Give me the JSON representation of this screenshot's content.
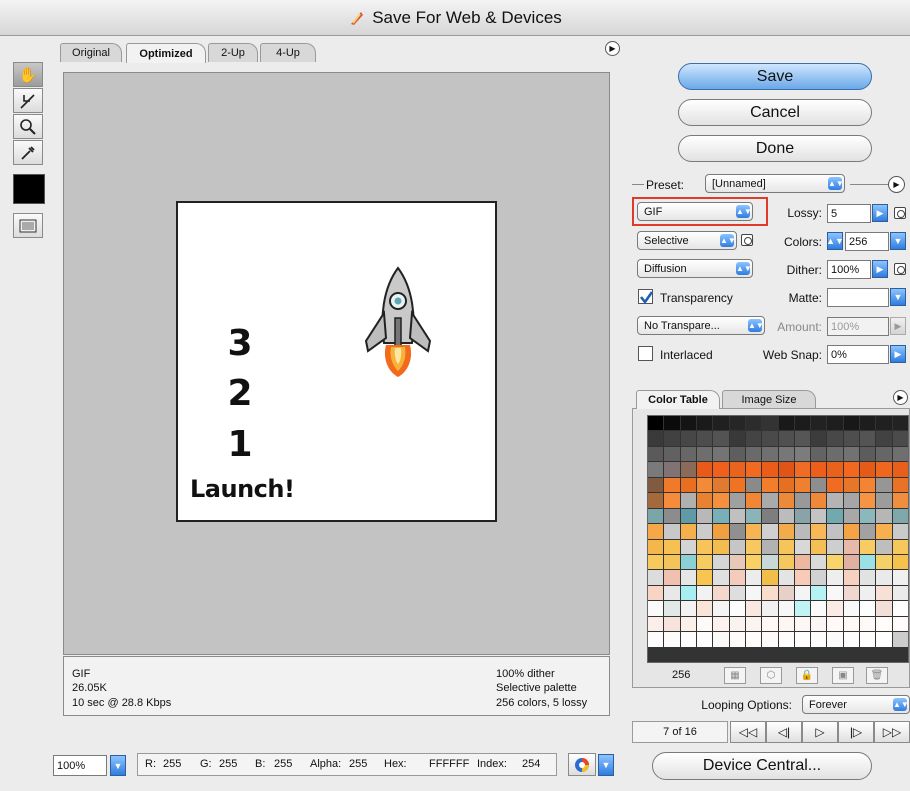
{
  "window": {
    "title": "Save For Web & Devices"
  },
  "tabs": [
    {
      "label": "Original",
      "active": false
    },
    {
      "label": "Optimized",
      "active": true
    },
    {
      "label": "2-Up",
      "active": false
    },
    {
      "label": "4-Up",
      "active": false
    }
  ],
  "toolbox": {
    "tools": [
      "hand-tool",
      "slice-select-tool",
      "zoom-tool",
      "eyedropper-tool"
    ],
    "eyedropper_color": "#000000"
  },
  "preview": {
    "count": [
      "3",
      "2",
      "1"
    ],
    "launch_text": "Launch!"
  },
  "info_left": [
    "GIF",
    "26.05K",
    "10 sec @ 28.8 Kbps"
  ],
  "info_right": [
    "100% dither",
    "Selective palette",
    "256 colors, 5 lossy"
  ],
  "buttons": {
    "save": "Save",
    "cancel": "Cancel",
    "done": "Done",
    "device_central": "Device Central..."
  },
  "settings": {
    "preset_label": "Preset:",
    "preset_value": "[Unnamed]",
    "format": "GIF",
    "lossy_label": "Lossy:",
    "lossy_value": "5",
    "palette": "Selective",
    "colors_label": "Colors:",
    "colors_value": "256",
    "dither_algo": "Diffusion",
    "dither_label": "Dither:",
    "dither_value": "100%",
    "transparency_label": "Transparency",
    "transparency_checked": true,
    "matte_label": "Matte:",
    "matte_value": "",
    "transparency_dither": "No Transpare...",
    "amount_label": "Amount:",
    "amount_value": "100%",
    "interlaced_label": "Interlaced",
    "interlaced_checked": false,
    "websnap_label": "Web Snap:",
    "websnap_value": "0%"
  },
  "color_table": {
    "tabs": [
      "Color Table",
      "Image Size"
    ],
    "count": "256",
    "colors": [
      "#000000",
      "#0b0b0b",
      "#141414",
      "#1a1a1a",
      "#202020",
      "#262626",
      "#2c2c2c",
      "#333333",
      "#191919",
      "#1c1c1c",
      "#222222",
      "#1e1e1e",
      "#181818",
      "#1d1d1d",
      "#202020",
      "#232323",
      "#3a3a3a",
      "#414141",
      "#474747",
      "#4d4d4d",
      "#535353",
      "#393939",
      "#444444",
      "#4a4a4a",
      "#505050",
      "#565656",
      "#3c3c3c",
      "#484848",
      "#4e4e4e",
      "#545454",
      "#424242",
      "#4b4b4b",
      "#5a5a5a",
      "#616161",
      "#676767",
      "#6e6e6e",
      "#747474",
      "#5e5e5e",
      "#6a6a6a",
      "#707070",
      "#777777",
      "#7c7c7c",
      "#636363",
      "#6c6c6c",
      "#727272",
      "#5c5c5c",
      "#666666",
      "#6f6f6f",
      "#7a7a7a",
      "#817373",
      "#8a6a58",
      "#e85a1a",
      "#f0601c",
      "#e8641e",
      "#f26a22",
      "#ea5c18",
      "#e05418",
      "#f06b24",
      "#ee5e1a",
      "#e8621c",
      "#f3681e",
      "#e55a16",
      "#ef661f",
      "#e75f1b",
      "#825a40",
      "#f07a2a",
      "#e86e20",
      "#f28a38",
      "#e07a30",
      "#ee7424",
      "#8a8a8a",
      "#f27e2c",
      "#e57022",
      "#ef8030",
      "#8e8e8e",
      "#f06c22",
      "#e87628",
      "#f38434",
      "#969696",
      "#ea7226",
      "#a46a3c",
      "#f48c3c",
      "#b0b0b0",
      "#e88232",
      "#f4903e",
      "#a0a0a0",
      "#f28634",
      "#aaaaaa",
      "#ec8a3a",
      "#999999",
      "#f0883a",
      "#b4b4b4",
      "#a6a6a6",
      "#f49444",
      "#9c9c9c",
      "#ee8e3e",
      "#7aa6aa",
      "#8c8c8c",
      "#5e9aa8",
      "#b8b8b8",
      "#78b0b8",
      "#c0c0c0",
      "#8ab4b8",
      "#7e7e7e",
      "#bcbcbc",
      "#88a4a8",
      "#c4c4c4",
      "#70aab0",
      "#a8a8a8",
      "#8ab8bc",
      "#b6b6b6",
      "#7fa8ac",
      "#f6a848",
      "#c8c8c8",
      "#f4b04c",
      "#cccccc",
      "#f0a040",
      "#909090",
      "#f6b452",
      "#d0d0d0",
      "#f2ac4a",
      "#bababa",
      "#f8b858",
      "#c2c2c2",
      "#f4a444",
      "#a2a2a2",
      "#f6b050",
      "#cacaca",
      "#f4b84a",
      "#f6c052",
      "#d4d4d4",
      "#f8c45a",
      "#f2bc4e",
      "#c6c6c6",
      "#f8c860",
      "#b2b2b2",
      "#f6c458",
      "#d8d8d8",
      "#f4c056",
      "#cecece",
      "#e8b8a8",
      "#f8cc62",
      "#bebebe",
      "#f6c85c",
      "#f8ca5c",
      "#f2c45a",
      "#8ad0d4",
      "#f6cc60",
      "#d6d6d6",
      "#e8c8b8",
      "#f8d066",
      "#c8d8d8",
      "#f4c85e",
      "#eeb8a0",
      "#dadada",
      "#f8d46a",
      "#e0b0a0",
      "#9ae0e4",
      "#f4d068",
      "#f6c24c",
      "#dcdcdc",
      "#f0c0b0",
      "#e6e6e6",
      "#f8c650",
      "#e0e0e0",
      "#f4ccbc",
      "#ececec",
      "#f2be4a",
      "#e4e4e4",
      "#f8cab8",
      "#d2d2d2",
      "#eeeeee",
      "#f6d0c0",
      "#e2e2e2",
      "#eaeaea",
      "#f0f0f0",
      "#f8d4c4",
      "#e8e8e8",
      "#a8eef0",
      "#f2f2f2",
      "#f4d8cc",
      "#dedede",
      "#f6f6f6",
      "#f8dccc",
      "#e6d0c8",
      "#f4f4f4",
      "#b4f2f4",
      "#f8f8f8",
      "#f0d8d0",
      "#efefef",
      "#f8e0d4",
      "#ebebeb",
      "#fafafa",
      "#e0e8e8",
      "#f3f3f3",
      "#fae4d8",
      "#f5f5f5",
      "#fcfcfc",
      "#f9e8e0",
      "#f1f1f1",
      "#f7f7f7",
      "#c0f4f4",
      "#fbfbfb",
      "#faece4",
      "#f9f9f9",
      "#fdfdfd",
      "#f2e0d8",
      "#fefefe",
      "#fceee8",
      "#f6e4dc",
      "#fbf0ea",
      "#fefaf8",
      "#fdf2ee",
      "#f9f3f0",
      "#fcf4f0",
      "#fff8f4",
      "#fef6f2",
      "#fdf8f6",
      "#fbf6f4",
      "#fffaf8",
      "#fef9f7",
      "#fcf9f8",
      "#fffcfa",
      "#fefbfa",
      "#fffdfc",
      "#fdfcfb",
      "#fffefe",
      "#fefdfd",
      "#fbfaf9",
      "#fffbf9",
      "#fffcfb",
      "#fdfaf9",
      "#fffdfb",
      "#fffefd",
      "#fefcfb",
      "#fcfbfa",
      "#fffdfd",
      "#fefefd",
      "#ffffff",
      "#cccccc"
    ],
    "toolbar": [
      "map-transparent-icon",
      "web-shift-icon",
      "lock-icon",
      "new-color-icon",
      "trash-icon"
    ]
  },
  "looping": {
    "label": "Looping Options:",
    "value": "Forever"
  },
  "animation": {
    "frame": "7 of 16",
    "controls": [
      "first-frame-icon",
      "prev-frame-icon",
      "play-icon",
      "next-frame-icon",
      "last-frame-icon"
    ]
  },
  "status": {
    "zoom": "100%",
    "r_label": "R:",
    "r": "255",
    "g_label": "G:",
    "g": "255",
    "b_label": "B:",
    "b": "255",
    "alpha_label": "Alpha:",
    "alpha": "255",
    "hex_label": "Hex:",
    "hex": "FFFFFF",
    "index_label": "Index:",
    "index": "254"
  }
}
